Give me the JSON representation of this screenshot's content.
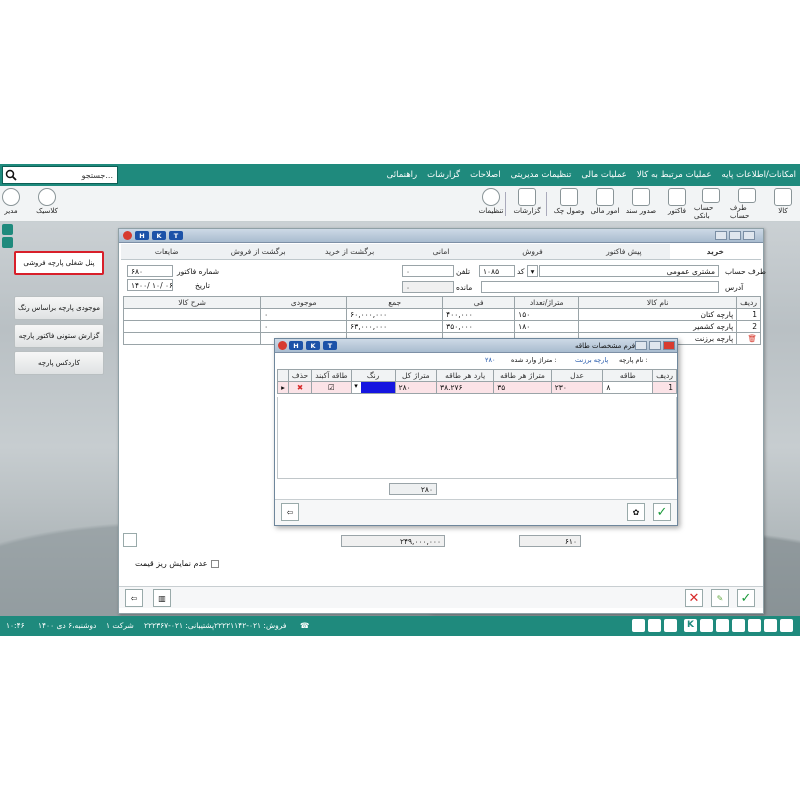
{
  "search": {
    "placeholder": "جستجو..."
  },
  "menu": [
    "امکانات/اطلاعات پایه",
    "عملیات مرتبط به کالا",
    "عملیات مالی",
    "تنظیمات مدیریتی",
    "اصلاحات",
    "گزارشات",
    "راهنمائی"
  ],
  "toolbar": {
    "right": [
      "کالا",
      "طرف حساب",
      "حساب بانکی",
      "فاکتور",
      "صدور سند",
      "امور مالی",
      "وصول چک",
      "گزارشات",
      "تنظیمات"
    ],
    "left": [
      "کلاسیک",
      "مدیر"
    ]
  },
  "side": {
    "panel": "پنل شغلی پارچه فروشی",
    "b1": "موجودی پارچه براساس رنگ",
    "b2": "گزارش ستونی فاکتور پارچه",
    "b3": "کاردکس پارچه"
  },
  "invoice": {
    "hkt": [
      "H",
      "K",
      "T"
    ],
    "tabs": [
      "خرید",
      "پیش فاکتور",
      "فروش",
      "امانی",
      "برگشت از خرید",
      "برگشت از فروش",
      "ضایعات"
    ],
    "party_label": "طرف حساب",
    "party_value": "مشتری عمومی",
    "code_label": "کد",
    "code_value": "۱۰۸۵",
    "phone_label": "تلفن",
    "phone_value": "۰",
    "balance_label": "مانده",
    "balance_value": "۰",
    "address_label": "آدرس",
    "invno_label": "شماره فاکتور",
    "invno_value": "۶۸۰",
    "date_label": "تاریخ",
    "date_value": "۱۴۰۰/ ۱۰/ ۰۶",
    "columns": [
      "ردیف",
      "نام کالا",
      "متراژ/تعداد",
      "فی",
      "جمع",
      "موجودی",
      "شرح کالا"
    ],
    "rows": [
      {
        "n": "1",
        "name": "پارچه کتان",
        "qty": "۱۵۰",
        "fee": "۴۰۰,۰۰۰",
        "sum": "۶۰,۰۰۰,۰۰۰",
        "stock": "۰",
        "desc": ""
      },
      {
        "n": "2",
        "name": "پارچه کشمیر",
        "qty": "۱۸۰",
        "fee": "۳۵۰,۰۰۰",
        "sum": "۶۳,۰۰۰,۰۰۰",
        "stock": "۰",
        "desc": ""
      },
      {
        "n": "",
        "name": "پارچه برزنت",
        "qty": "",
        "fee": "",
        "sum": "",
        "stock": "",
        "desc": ""
      }
    ],
    "total_sum": "۲۴۹,۰۰۰,۰۰۰",
    "total_qty": "۶۱۰",
    "hide_price_label": "عدم نمایش ریز قیمت"
  },
  "dialog": {
    "hkt": [
      "H",
      "K",
      "T"
    ],
    "title": "فرم مشخصات طاقه",
    "item_label": "نام پارچه :",
    "item_value": "پارچه برزنت",
    "entered_label": "متراژ وارد شده :",
    "entered_value": "۲۸۰",
    "columns": [
      "ردیف",
      "طاقه",
      "عدل",
      "متراژ هر طاقه",
      "یارد هر طاقه",
      "متراژ کل",
      "رنگ",
      "طاقه آکبند",
      "حذف"
    ],
    "rows": [
      {
        "n": "1",
        "roll": "۸",
        "bale": "۲۳۰",
        "m_each": "۳۵",
        "yd_each": "۳۸.۲۷۶",
        "m_total": "۲۸۰",
        "color": "",
        "sealed": true
      }
    ],
    "footer_total": "۲۸۰"
  },
  "status": {
    "time": "۱۰:۴۶",
    "date": "دوشنبه،۶ دی ۱۴۰۰",
    "company": "شرکت ۱",
    "sales": "فروش: ۰۲۱-۲۲۲۲۱۱۴۲",
    "support": "پشتیبانی: ۰۲۱-۲۲۲۳۶۷"
  },
  "colors": {
    "teal": "#1f8a7d",
    "panel_border": "#d81f2a",
    "blue": "#1c52a8"
  }
}
